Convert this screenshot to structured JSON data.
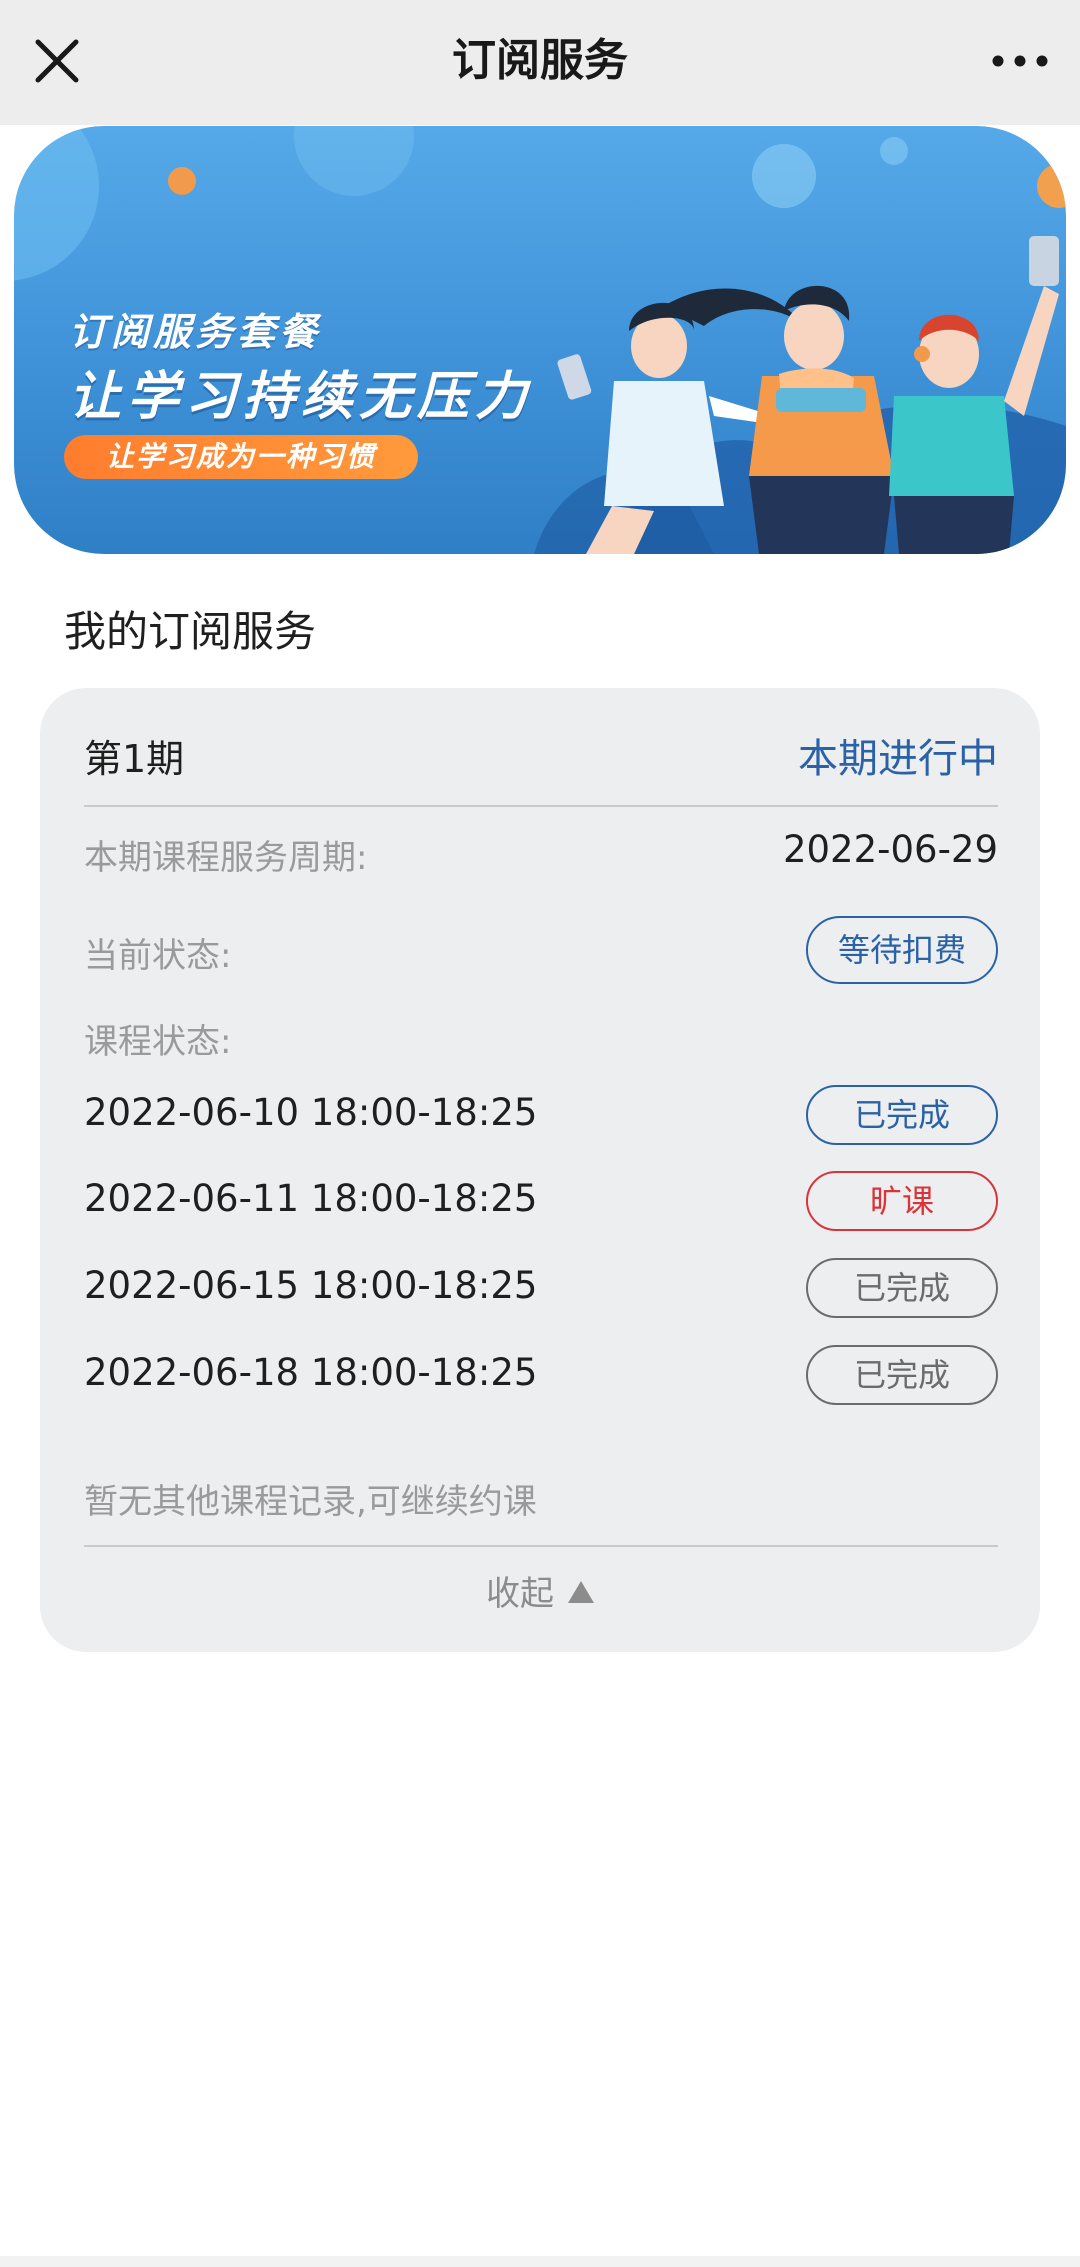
{
  "header": {
    "title": "订阅服务",
    "close_icon": "close-icon",
    "more_icon": "more-horizontal-icon"
  },
  "banner": {
    "title": "订阅服务套餐",
    "slogan": "让学习持续无压力",
    "pill": "让学习成为一种习惯",
    "colors": {
      "bg_top": "#56a9e8",
      "bg_bottom": "#2f7fc6",
      "pill": "#ff8a33"
    }
  },
  "section": {
    "title": "我的订阅服务"
  },
  "subscription": {
    "period_label": "第1期",
    "period_status": "本期进行中",
    "service_period_label": "本期课程服务周期:",
    "service_period_value": "2022-06-29",
    "current_status_label": "当前状态:",
    "current_status_value": "等待扣费",
    "course_status_label": "课程状态:",
    "sessions": [
      {
        "time": "2022-06-10 18:00-18:25",
        "status": "已完成"
      },
      {
        "time": "2022-06-11 18:00-18:25",
        "status": "旷课"
      },
      {
        "time": "2022-06-15 18:00-18:25",
        "status": "已完成"
      },
      {
        "time": "2022-06-18 18:00-18:25",
        "status": "已完成"
      }
    ],
    "footnote": "暂无其他课程记录,可继续约课",
    "collapse_label": "收起"
  },
  "colors": {
    "accent_blue": "#2b62a7",
    "absent_red": "#d9343a",
    "muted_gray": "#6b6b6b",
    "card_bg": "#edeeef"
  }
}
